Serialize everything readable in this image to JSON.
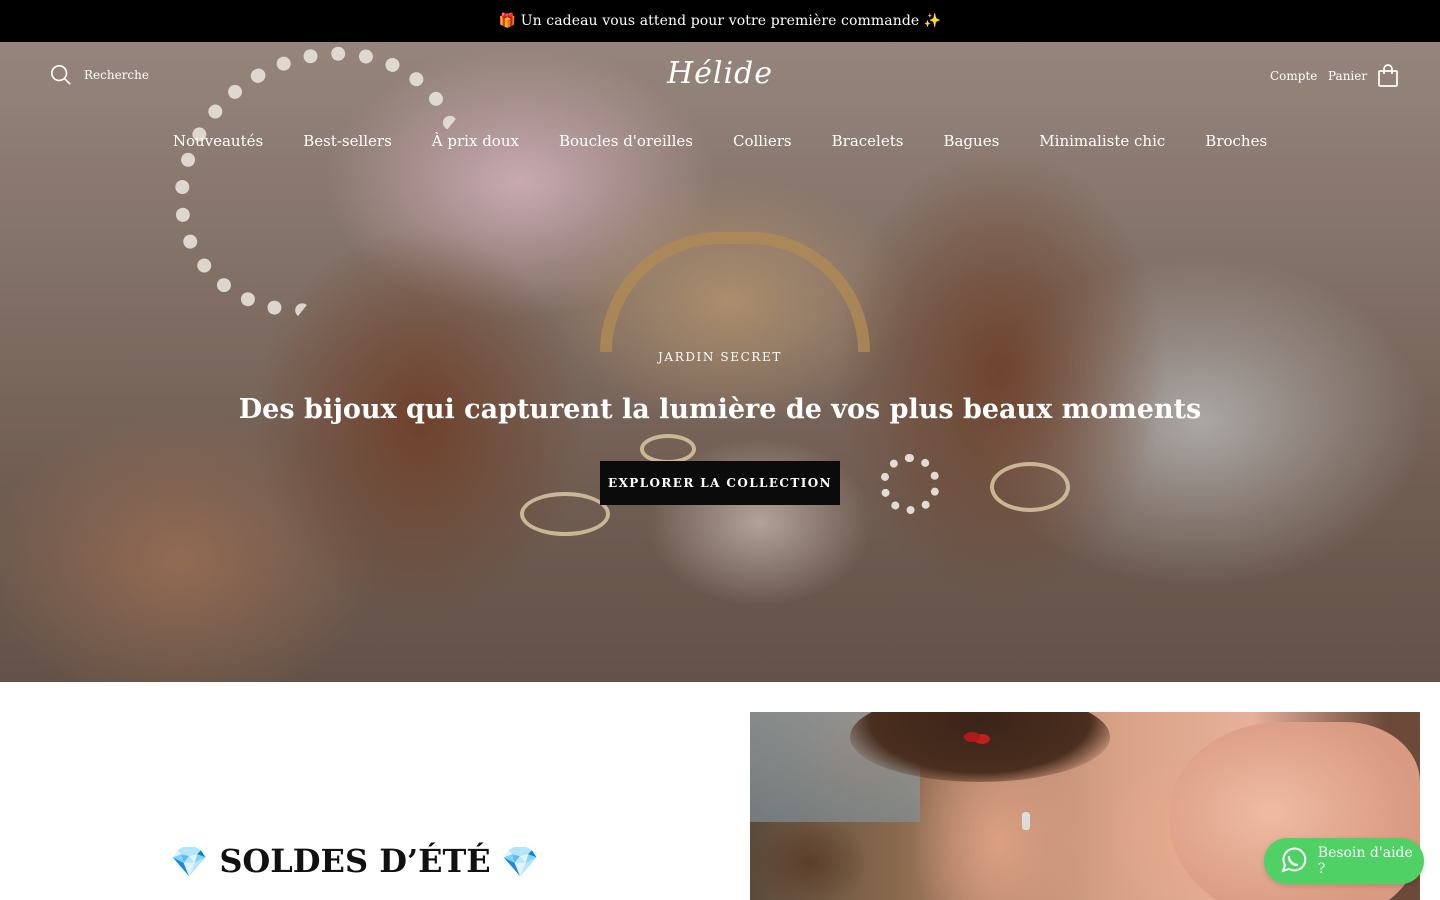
{
  "announcement": {
    "text": "🎁 Un cadeau vous attend pour votre première commande ✨"
  },
  "header": {
    "search_label": "Recherche",
    "logo": "Hélide",
    "account_label": "Compte",
    "cart_label": "Panier"
  },
  "nav": {
    "items": [
      "Nouveautés",
      "Best-sellers",
      "À prix doux",
      "Boucles d'oreilles",
      "Colliers",
      "Bracelets",
      "Bagues",
      "Minimaliste chic",
      "Broches"
    ]
  },
  "hero": {
    "eyebrow": "JARDIN SECRET",
    "headline": "Des bijoux qui capturent la lumière de vos plus beaux moments",
    "cta": "EXPLORER LA COLLECTION"
  },
  "promo": {
    "gem_left": "💎",
    "title": "SOLDES D’ÉTÉ",
    "gem_right": "💎"
  },
  "help_widget": {
    "label": "Besoin d'aide ?"
  },
  "colors": {
    "announcement_bg": "#000000",
    "cta_bg": "#0b0b0b",
    "help_bg": "#4fd165"
  }
}
